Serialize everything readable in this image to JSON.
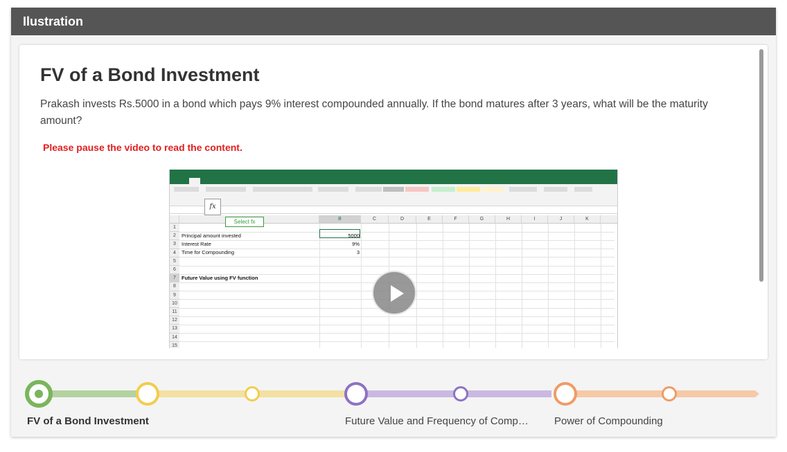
{
  "panel": {
    "header": "Ilustration"
  },
  "slide": {
    "title": "FV of a Bond Investment",
    "description": "Prakash invests Rs.5000 in a bond which pays 9% interest compounded annually. If the bond matures after 3 years, what will be the maturity amount?",
    "notice": "Please pause the video to read the content."
  },
  "video": {
    "play_icon": "play-icon",
    "excel": {
      "fx_label": "fx",
      "tooltip": "Select fx",
      "columns": [
        "B",
        "C",
        "D",
        "E",
        "F",
        "G",
        "H",
        "I",
        "J",
        "K"
      ],
      "rows": [
        "1",
        "2",
        "3",
        "4",
        "5",
        "6",
        "7",
        "8",
        "9",
        "10",
        "11",
        "12",
        "13",
        "14",
        "15"
      ],
      "cells": {
        "a2": "Principal amount invested",
        "b2": "5000",
        "a3": "Interest Rate",
        "b3": "9%",
        "a4": "Time for Compounding",
        "b4": "3",
        "a7": "Future Value using FV function"
      }
    }
  },
  "timeline": {
    "labels": [
      "FV of a Bond Investment",
      "Future Value and Frequency of Comp…",
      "Power of Compounding"
    ],
    "colors": {
      "green": "#7ab55c",
      "yellow": "#f1cd4f",
      "purple": "#8e72c3",
      "orange": "#ef9c66"
    }
  }
}
